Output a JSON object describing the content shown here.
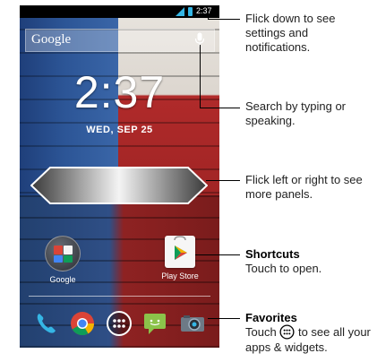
{
  "status_bar": {
    "time": "2:37"
  },
  "search": {
    "brand": "Google"
  },
  "clock": {
    "time": "2:37",
    "date": "WED, SEP 25"
  },
  "shortcuts": [
    {
      "label": "Google"
    },
    {
      "label": "Play Store"
    }
  ],
  "dock": [
    {
      "icon": "phone-icon"
    },
    {
      "icon": "chrome-icon"
    },
    {
      "icon": "apps-launcher-icon"
    },
    {
      "icon": "messaging-icon"
    },
    {
      "icon": "camera-icon"
    }
  ],
  "annotations": {
    "notifications": "Flick down to see settings and notifications.",
    "search": "Search by typing or speaking.",
    "panels": "Flick left or right to see more panels.",
    "shortcuts_title": "Shortcuts",
    "shortcuts_desc": "Touch to open.",
    "favorites_title": "Favorites",
    "favorites_desc_a": "Touch",
    "favorites_desc_b": "to see all your apps & widgets."
  },
  "colors": {
    "accent": "#35b6e5",
    "wall_blue": "#2c5596",
    "wall_red": "#9e2424"
  }
}
